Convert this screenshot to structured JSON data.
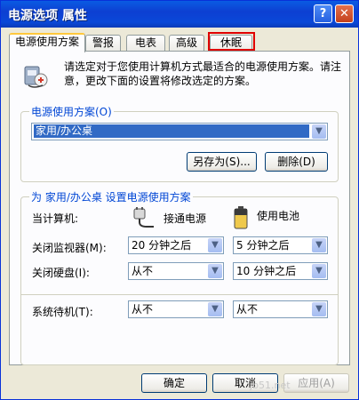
{
  "window": {
    "title": "电源选项 属性",
    "help_glyph": "?",
    "close_glyph": "✕"
  },
  "tabs": [
    {
      "label": "电源使用方案",
      "active": true
    },
    {
      "label": "警报"
    },
    {
      "label": "电表"
    },
    {
      "label": "高级"
    },
    {
      "label": "休眠",
      "highlighted": true
    }
  ],
  "info": {
    "text": "请选定对于您使用计算机方式最适合的电源使用方案。请注意，更改下面的设置将修改选定的方案。"
  },
  "scheme_group": {
    "title": "电源使用方案(O)",
    "selected": "家用/办公桌",
    "save_as_label": "另存为(S)...",
    "delete_label": "删除(D)"
  },
  "settings_group": {
    "title": "为 家用/办公桌 设置电源使用方案",
    "computer_label": "当计算机:",
    "plugged_label": "接通电源",
    "battery_label": "使用电池",
    "rows": [
      {
        "label": "关闭监视器(M):",
        "plugged": "20 分钟之后",
        "battery": "5 分钟之后"
      },
      {
        "label": "关闭硬盘(I):",
        "plugged": "从不",
        "battery": "10 分钟之后"
      },
      {
        "label": "系统待机(T):",
        "plugged": "从不",
        "battery": "从不"
      }
    ]
  },
  "footer": {
    "ok_label": "确定",
    "cancel_label": "取消",
    "apply_label": "应用(A)"
  },
  "watermark": "jb51.net",
  "colors": {
    "title_bar": "#0a5ce3",
    "group_title": "#0046d5",
    "highlight_box": "#e00000",
    "selection": "#316ac5"
  },
  "icons": {
    "info": "power-options-icon",
    "plugged": "power-plug-icon",
    "battery": "battery-icon"
  }
}
